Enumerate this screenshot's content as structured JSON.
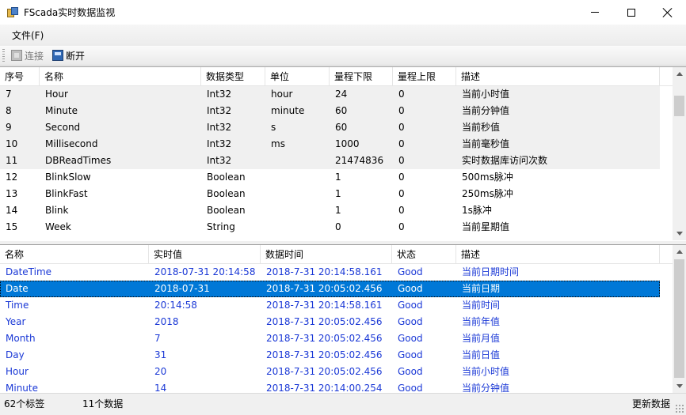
{
  "window": {
    "title": "FScada实时数据监视"
  },
  "menu": {
    "items": [
      {
        "label": "文件(F)"
      }
    ]
  },
  "toolbar": {
    "connect_label": "连接",
    "disconnect_label": "断开"
  },
  "tag_table": {
    "columns": [
      "序号",
      "名称",
      "数据类型",
      "单位",
      "量程下限",
      "量程上限",
      "描述"
    ],
    "rows": [
      {
        "cells": [
          "7",
          "Hour",
          "Int32",
          "hour",
          "24",
          "0",
          "当前小时值"
        ]
      },
      {
        "cells": [
          "8",
          "Minute",
          "Int32",
          "minute",
          "60",
          "0",
          "当前分钟值"
        ]
      },
      {
        "cells": [
          "9",
          "Second",
          "Int32",
          "s",
          "60",
          "0",
          "当前秒值"
        ]
      },
      {
        "cells": [
          "10",
          "Millisecond",
          "Int32",
          "ms",
          "1000",
          "0",
          "当前毫秒值"
        ]
      },
      {
        "cells": [
          "11",
          "DBReadTimes",
          "Int32",
          "",
          "21474836",
          "0",
          "实时数据库访问次数"
        ]
      },
      {
        "cells": [
          "12",
          "BlinkSlow",
          "Boolean",
          "",
          "1",
          "0",
          "500ms脉冲"
        ]
      },
      {
        "cells": [
          "13",
          "BlinkFast",
          "Boolean",
          "",
          "1",
          "0",
          "250ms脉冲"
        ]
      },
      {
        "cells": [
          "14",
          "Blink",
          "Boolean",
          "",
          "1",
          "0",
          "1s脉冲"
        ]
      },
      {
        "cells": [
          "15",
          "Week",
          "String",
          "",
          "0",
          "0",
          "当前星期值"
        ]
      }
    ]
  },
  "value_table": {
    "columns": [
      "名称",
      "实时值",
      "数据时间",
      "状态",
      "描述"
    ],
    "rows": [
      {
        "cells": [
          "DateTime",
          "2018-07-31 20:14:58",
          "2018-7-31 20:14:58.161",
          "Good",
          "当前日期时间"
        ]
      },
      {
        "cells": [
          "Date",
          "2018-07-31",
          "2018-7-31 20:05:02.456",
          "Good",
          "当前日期"
        ]
      },
      {
        "cells": [
          "Time",
          "20:14:58",
          "2018-7-31 20:14:58.161",
          "Good",
          "当前时间"
        ]
      },
      {
        "cells": [
          "Year",
          "2018",
          "2018-7-31 20:05:02.456",
          "Good",
          "当前年值"
        ]
      },
      {
        "cells": [
          "Month",
          "7",
          "2018-7-31 20:05:02.456",
          "Good",
          "当前月值"
        ]
      },
      {
        "cells": [
          "Day",
          "31",
          "2018-7-31 20:05:02.456",
          "Good",
          "当前日值"
        ]
      },
      {
        "cells": [
          "Hour",
          "20",
          "2018-7-31 20:05:02.456",
          "Good",
          "当前小时值"
        ]
      },
      {
        "cells": [
          "Minute",
          "14",
          "2018-7-31 20:14:00.254",
          "Good",
          "当前分钟值"
        ]
      }
    ]
  },
  "status_bar": {
    "tag_count": "62个标签",
    "data_count": "11个数据",
    "update_text": "更新数据"
  },
  "colors": {
    "selection": "#0078d7",
    "value_text": "#1a38d6",
    "row_grey": "#f0f0f0"
  }
}
